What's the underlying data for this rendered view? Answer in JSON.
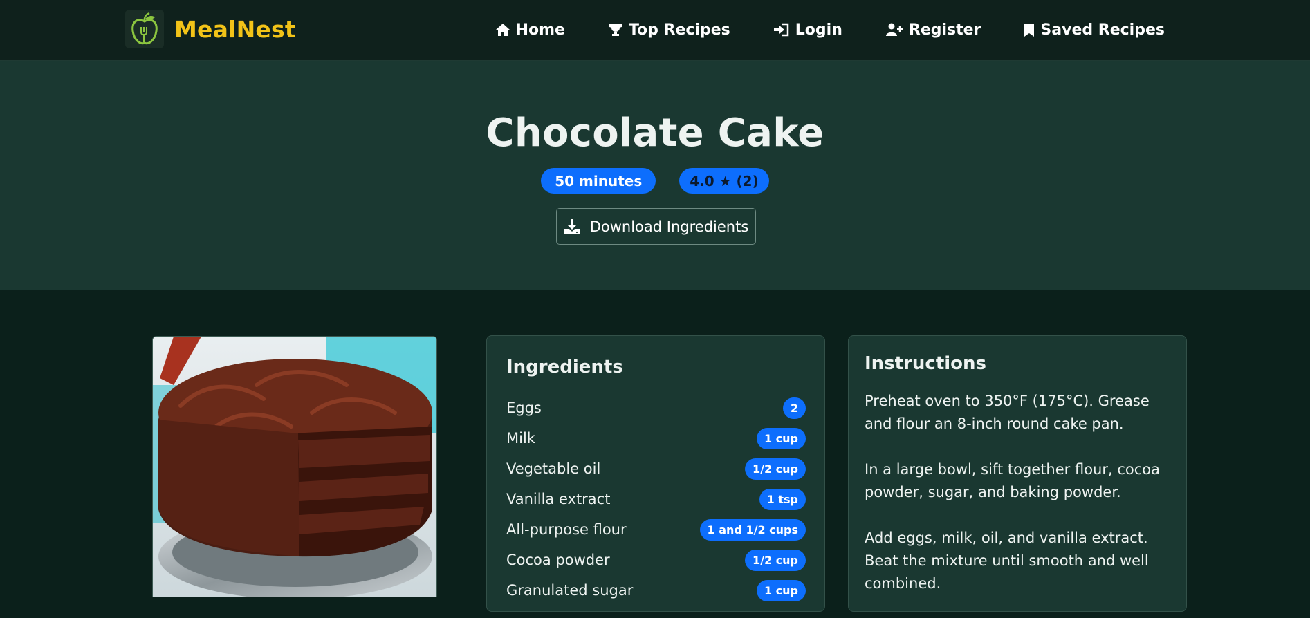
{
  "brand": {
    "name": "MealNest",
    "logo_icon": "apple-fork-icon"
  },
  "nav": {
    "items": [
      {
        "label": "Home",
        "icon": "home-icon"
      },
      {
        "label": "Top Recipes",
        "icon": "trophy-icon"
      },
      {
        "label": "Login",
        "icon": "sign-in-icon"
      },
      {
        "label": "Register",
        "icon": "user-plus-icon"
      },
      {
        "label": "Saved Recipes",
        "icon": "bookmark-icon"
      }
    ]
  },
  "recipe": {
    "title": "Chocolate Cake",
    "time": "50 minutes",
    "rating": "4.0 ★ (2)",
    "download_label": "Download Ingredients",
    "image_alt": "Chocolate cake with slice removed"
  },
  "ingredients": {
    "heading": "Ingredients",
    "items": [
      {
        "name": "Eggs",
        "qty": "2"
      },
      {
        "name": "Milk",
        "qty": "1 cup"
      },
      {
        "name": "Vegetable oil",
        "qty": "1/2 cup"
      },
      {
        "name": "Vanilla extract",
        "qty": "1 tsp"
      },
      {
        "name": "All-purpose flour",
        "qty": "1 and 1/2 cups"
      },
      {
        "name": "Cocoa powder",
        "qty": "1/2 cup"
      },
      {
        "name": "Granulated sugar",
        "qty": "1 cup"
      }
    ]
  },
  "instructions": {
    "heading": "Instructions",
    "steps": [
      "Preheat oven to 350°F (175°C). Grease and flour an 8-inch round cake pan.",
      "In a large bowl, sift together flour, cocoa powder, sugar, and baking powder.",
      "Add eggs, milk, oil, and vanilla extract. Beat the mixture until smooth and well combined."
    ]
  },
  "colors": {
    "brand": "#f2c318",
    "accent": "#0d6efd",
    "navbar_bg": "#0f211c",
    "hero_bg": "#1a3831",
    "page_bg": "#0b201b"
  }
}
